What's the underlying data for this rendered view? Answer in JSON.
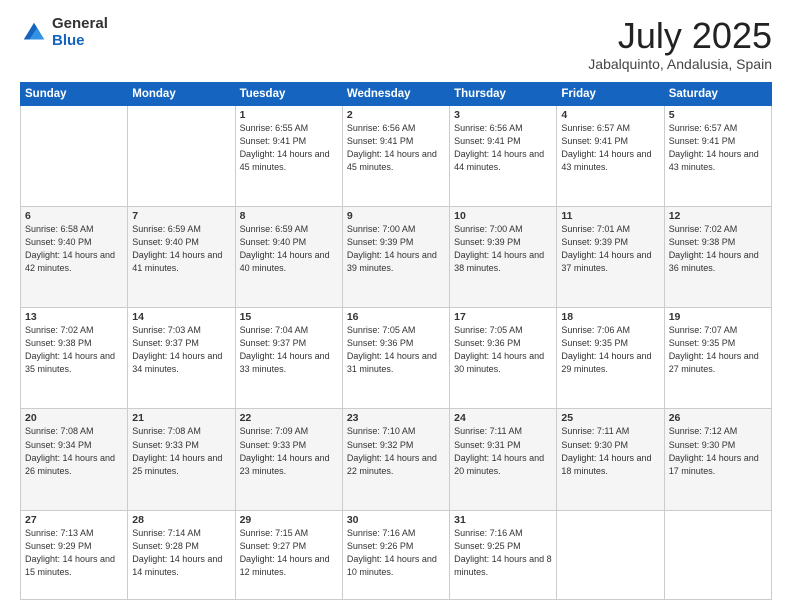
{
  "logo": {
    "general": "General",
    "blue": "Blue"
  },
  "title": "July 2025",
  "location": "Jabalquinto, Andalusia, Spain",
  "weekdays": [
    "Sunday",
    "Monday",
    "Tuesday",
    "Wednesday",
    "Thursday",
    "Friday",
    "Saturday"
  ],
  "weeks": [
    [
      {
        "day": "",
        "sunrise": "",
        "sunset": "",
        "daylight": "",
        "empty": true
      },
      {
        "day": "",
        "sunrise": "",
        "sunset": "",
        "daylight": "",
        "empty": true
      },
      {
        "day": "1",
        "sunrise": "Sunrise: 6:55 AM",
        "sunset": "Sunset: 9:41 PM",
        "daylight": "Daylight: 14 hours and 45 minutes."
      },
      {
        "day": "2",
        "sunrise": "Sunrise: 6:56 AM",
        "sunset": "Sunset: 9:41 PM",
        "daylight": "Daylight: 14 hours and 45 minutes."
      },
      {
        "day": "3",
        "sunrise": "Sunrise: 6:56 AM",
        "sunset": "Sunset: 9:41 PM",
        "daylight": "Daylight: 14 hours and 44 minutes."
      },
      {
        "day": "4",
        "sunrise": "Sunrise: 6:57 AM",
        "sunset": "Sunset: 9:41 PM",
        "daylight": "Daylight: 14 hours and 43 minutes."
      },
      {
        "day": "5",
        "sunrise": "Sunrise: 6:57 AM",
        "sunset": "Sunset: 9:41 PM",
        "daylight": "Daylight: 14 hours and 43 minutes."
      }
    ],
    [
      {
        "day": "6",
        "sunrise": "Sunrise: 6:58 AM",
        "sunset": "Sunset: 9:40 PM",
        "daylight": "Daylight: 14 hours and 42 minutes."
      },
      {
        "day": "7",
        "sunrise": "Sunrise: 6:59 AM",
        "sunset": "Sunset: 9:40 PM",
        "daylight": "Daylight: 14 hours and 41 minutes."
      },
      {
        "day": "8",
        "sunrise": "Sunrise: 6:59 AM",
        "sunset": "Sunset: 9:40 PM",
        "daylight": "Daylight: 14 hours and 40 minutes."
      },
      {
        "day": "9",
        "sunrise": "Sunrise: 7:00 AM",
        "sunset": "Sunset: 9:39 PM",
        "daylight": "Daylight: 14 hours and 39 minutes."
      },
      {
        "day": "10",
        "sunrise": "Sunrise: 7:00 AM",
        "sunset": "Sunset: 9:39 PM",
        "daylight": "Daylight: 14 hours and 38 minutes."
      },
      {
        "day": "11",
        "sunrise": "Sunrise: 7:01 AM",
        "sunset": "Sunset: 9:39 PM",
        "daylight": "Daylight: 14 hours and 37 minutes."
      },
      {
        "day": "12",
        "sunrise": "Sunrise: 7:02 AM",
        "sunset": "Sunset: 9:38 PM",
        "daylight": "Daylight: 14 hours and 36 minutes."
      }
    ],
    [
      {
        "day": "13",
        "sunrise": "Sunrise: 7:02 AM",
        "sunset": "Sunset: 9:38 PM",
        "daylight": "Daylight: 14 hours and 35 minutes."
      },
      {
        "day": "14",
        "sunrise": "Sunrise: 7:03 AM",
        "sunset": "Sunset: 9:37 PM",
        "daylight": "Daylight: 14 hours and 34 minutes."
      },
      {
        "day": "15",
        "sunrise": "Sunrise: 7:04 AM",
        "sunset": "Sunset: 9:37 PM",
        "daylight": "Daylight: 14 hours and 33 minutes."
      },
      {
        "day": "16",
        "sunrise": "Sunrise: 7:05 AM",
        "sunset": "Sunset: 9:36 PM",
        "daylight": "Daylight: 14 hours and 31 minutes."
      },
      {
        "day": "17",
        "sunrise": "Sunrise: 7:05 AM",
        "sunset": "Sunset: 9:36 PM",
        "daylight": "Daylight: 14 hours and 30 minutes."
      },
      {
        "day": "18",
        "sunrise": "Sunrise: 7:06 AM",
        "sunset": "Sunset: 9:35 PM",
        "daylight": "Daylight: 14 hours and 29 minutes."
      },
      {
        "day": "19",
        "sunrise": "Sunrise: 7:07 AM",
        "sunset": "Sunset: 9:35 PM",
        "daylight": "Daylight: 14 hours and 27 minutes."
      }
    ],
    [
      {
        "day": "20",
        "sunrise": "Sunrise: 7:08 AM",
        "sunset": "Sunset: 9:34 PM",
        "daylight": "Daylight: 14 hours and 26 minutes."
      },
      {
        "day": "21",
        "sunrise": "Sunrise: 7:08 AM",
        "sunset": "Sunset: 9:33 PM",
        "daylight": "Daylight: 14 hours and 25 minutes."
      },
      {
        "day": "22",
        "sunrise": "Sunrise: 7:09 AM",
        "sunset": "Sunset: 9:33 PM",
        "daylight": "Daylight: 14 hours and 23 minutes."
      },
      {
        "day": "23",
        "sunrise": "Sunrise: 7:10 AM",
        "sunset": "Sunset: 9:32 PM",
        "daylight": "Daylight: 14 hours and 22 minutes."
      },
      {
        "day": "24",
        "sunrise": "Sunrise: 7:11 AM",
        "sunset": "Sunset: 9:31 PM",
        "daylight": "Daylight: 14 hours and 20 minutes."
      },
      {
        "day": "25",
        "sunrise": "Sunrise: 7:11 AM",
        "sunset": "Sunset: 9:30 PM",
        "daylight": "Daylight: 14 hours and 18 minutes."
      },
      {
        "day": "26",
        "sunrise": "Sunrise: 7:12 AM",
        "sunset": "Sunset: 9:30 PM",
        "daylight": "Daylight: 14 hours and 17 minutes."
      }
    ],
    [
      {
        "day": "27",
        "sunrise": "Sunrise: 7:13 AM",
        "sunset": "Sunset: 9:29 PM",
        "daylight": "Daylight: 14 hours and 15 minutes."
      },
      {
        "day": "28",
        "sunrise": "Sunrise: 7:14 AM",
        "sunset": "Sunset: 9:28 PM",
        "daylight": "Daylight: 14 hours and 14 minutes."
      },
      {
        "day": "29",
        "sunrise": "Sunrise: 7:15 AM",
        "sunset": "Sunset: 9:27 PM",
        "daylight": "Daylight: 14 hours and 12 minutes."
      },
      {
        "day": "30",
        "sunrise": "Sunrise: 7:16 AM",
        "sunset": "Sunset: 9:26 PM",
        "daylight": "Daylight: 14 hours and 10 minutes."
      },
      {
        "day": "31",
        "sunrise": "Sunrise: 7:16 AM",
        "sunset": "Sunset: 9:25 PM",
        "daylight": "Daylight: 14 hours and 8 minutes."
      },
      {
        "day": "",
        "sunrise": "",
        "sunset": "",
        "daylight": "",
        "empty": true
      },
      {
        "day": "",
        "sunrise": "",
        "sunset": "",
        "daylight": "",
        "empty": true
      }
    ]
  ]
}
